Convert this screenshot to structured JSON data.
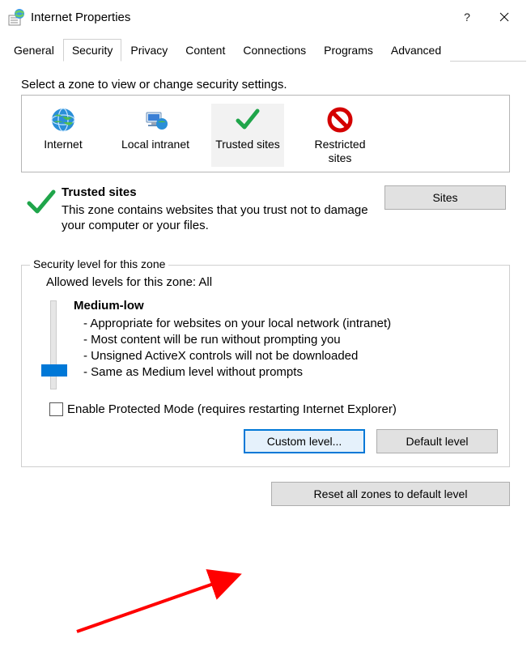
{
  "window": {
    "title": "Internet Properties",
    "help": "?"
  },
  "tabs": [
    "General",
    "Security",
    "Privacy",
    "Content",
    "Connections",
    "Programs",
    "Advanced"
  ],
  "active_tab": 1,
  "zone_prompt": "Select a zone to view or change security settings.",
  "zones": {
    "internet": "Internet",
    "local": "Local intranet",
    "trusted": "Trusted sites",
    "restricted": "Restricted sites"
  },
  "selected_zone": "trusted",
  "desc": {
    "title": "Trusted sites",
    "body": "This zone contains websites that you trust not to damage your computer or your files."
  },
  "sites_btn": "Sites",
  "fieldset_legend": "Security level for this zone",
  "allowed": "Allowed levels for this zone: All",
  "level": {
    "name": "Medium-low",
    "b1": "- Appropriate for websites on your local network (intranet)",
    "b2": "- Most content will be run without prompting you",
    "b3": "- Unsigned ActiveX controls will not be downloaded",
    "b4": "- Same as Medium level without prompts"
  },
  "protected_mode": "Enable Protected Mode (requires restarting Internet Explorer)",
  "buttons": {
    "custom": "Custom level...",
    "default": "Default level",
    "reset": "Reset all zones to default level"
  }
}
